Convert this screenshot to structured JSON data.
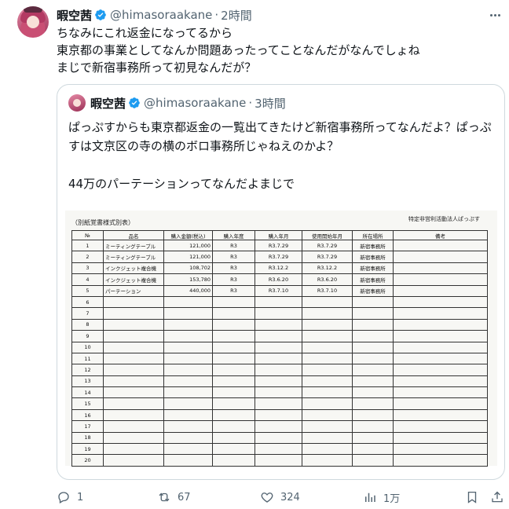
{
  "tweet": {
    "name": "暇空茜",
    "handle": "@himasoraakane",
    "separator": "·",
    "time": "2時間",
    "text": "ちなみにこれ返金になってるから\n東京都の事業としてなんか問題あったってことなんだがなんでしょね\nまじで新宿事務所って初見なんだが？"
  },
  "quote": {
    "name": "暇空茜",
    "handle": "@himasoraakane",
    "separator": "·",
    "time": "3時間",
    "text": "ぱっぷすからも東京都返金の一覧出てきたけど新宿事務所ってなんだよ？ぱっぷすは文京区の寺の横のボロ事務所じゃねえのかよ？\n\n44万のパーテーションってなんだよまじで"
  },
  "document": {
    "title": "（別紙覚書様式別表）",
    "org": "特定非営利活動法人ぱっぷす",
    "headers": [
      "№",
      "品名",
      "購入金額(税込)",
      "購入年度",
      "購入年月",
      "使用開始年月",
      "所在場所",
      "備考"
    ],
    "rows": [
      [
        "1",
        "ミーティングテーブル",
        "121,000",
        "R3",
        "R3.7.29",
        "R3.7.29",
        "新宿事務所",
        ""
      ],
      [
        "2",
        "ミーティングテーブル",
        "121,000",
        "R3",
        "R3.7.29",
        "R3.7.29",
        "新宿事務所",
        ""
      ],
      [
        "3",
        "インクジェット複合機",
        "108,702",
        "R3",
        "R3.12.2",
        "R3.12.2",
        "新宿事務所",
        ""
      ],
      [
        "4",
        "インクジェット複合機",
        "153,780",
        "R3",
        "R3.6.20",
        "R3.6.20",
        "新宿事務所",
        ""
      ],
      [
        "5",
        "パーテーション",
        "440,000",
        "R3",
        "R3.7.10",
        "R3.7.10",
        "新宿事務所",
        ""
      ],
      [
        "6",
        "",
        "",
        "",
        "",
        "",
        "",
        ""
      ],
      [
        "7",
        "",
        "",
        "",
        "",
        "",
        "",
        ""
      ],
      [
        "8",
        "",
        "",
        "",
        "",
        "",
        "",
        ""
      ],
      [
        "9",
        "",
        "",
        "",
        "",
        "",
        "",
        ""
      ],
      [
        "10",
        "",
        "",
        "",
        "",
        "",
        "",
        ""
      ],
      [
        "11",
        "",
        "",
        "",
        "",
        "",
        "",
        ""
      ],
      [
        "12",
        "",
        "",
        "",
        "",
        "",
        "",
        ""
      ],
      [
        "13",
        "",
        "",
        "",
        "",
        "",
        "",
        ""
      ],
      [
        "14",
        "",
        "",
        "",
        "",
        "",
        "",
        ""
      ],
      [
        "15",
        "",
        "",
        "",
        "",
        "",
        "",
        ""
      ],
      [
        "16",
        "",
        "",
        "",
        "",
        "",
        "",
        ""
      ],
      [
        "17",
        "",
        "",
        "",
        "",
        "",
        "",
        ""
      ],
      [
        "18",
        "",
        "",
        "",
        "",
        "",
        "",
        ""
      ],
      [
        "19",
        "",
        "",
        "",
        "",
        "",
        "",
        ""
      ],
      [
        "20",
        "",
        "",
        "",
        "",
        "",
        "",
        ""
      ]
    ]
  },
  "actions": {
    "reply_count": "1",
    "repost_count": "67",
    "like_count": "324",
    "view_count": "1万"
  },
  "icons": {
    "more": "more-icon",
    "verified": "verified-badge-icon",
    "reply": "reply-icon",
    "repost": "repost-icon",
    "like": "like-icon",
    "views": "views-icon",
    "bookmark": "bookmark-icon",
    "share": "share-icon"
  },
  "colors": {
    "verified": "#1d9bf0",
    "secondary_text": "#536471",
    "border": "#cfd9de"
  }
}
